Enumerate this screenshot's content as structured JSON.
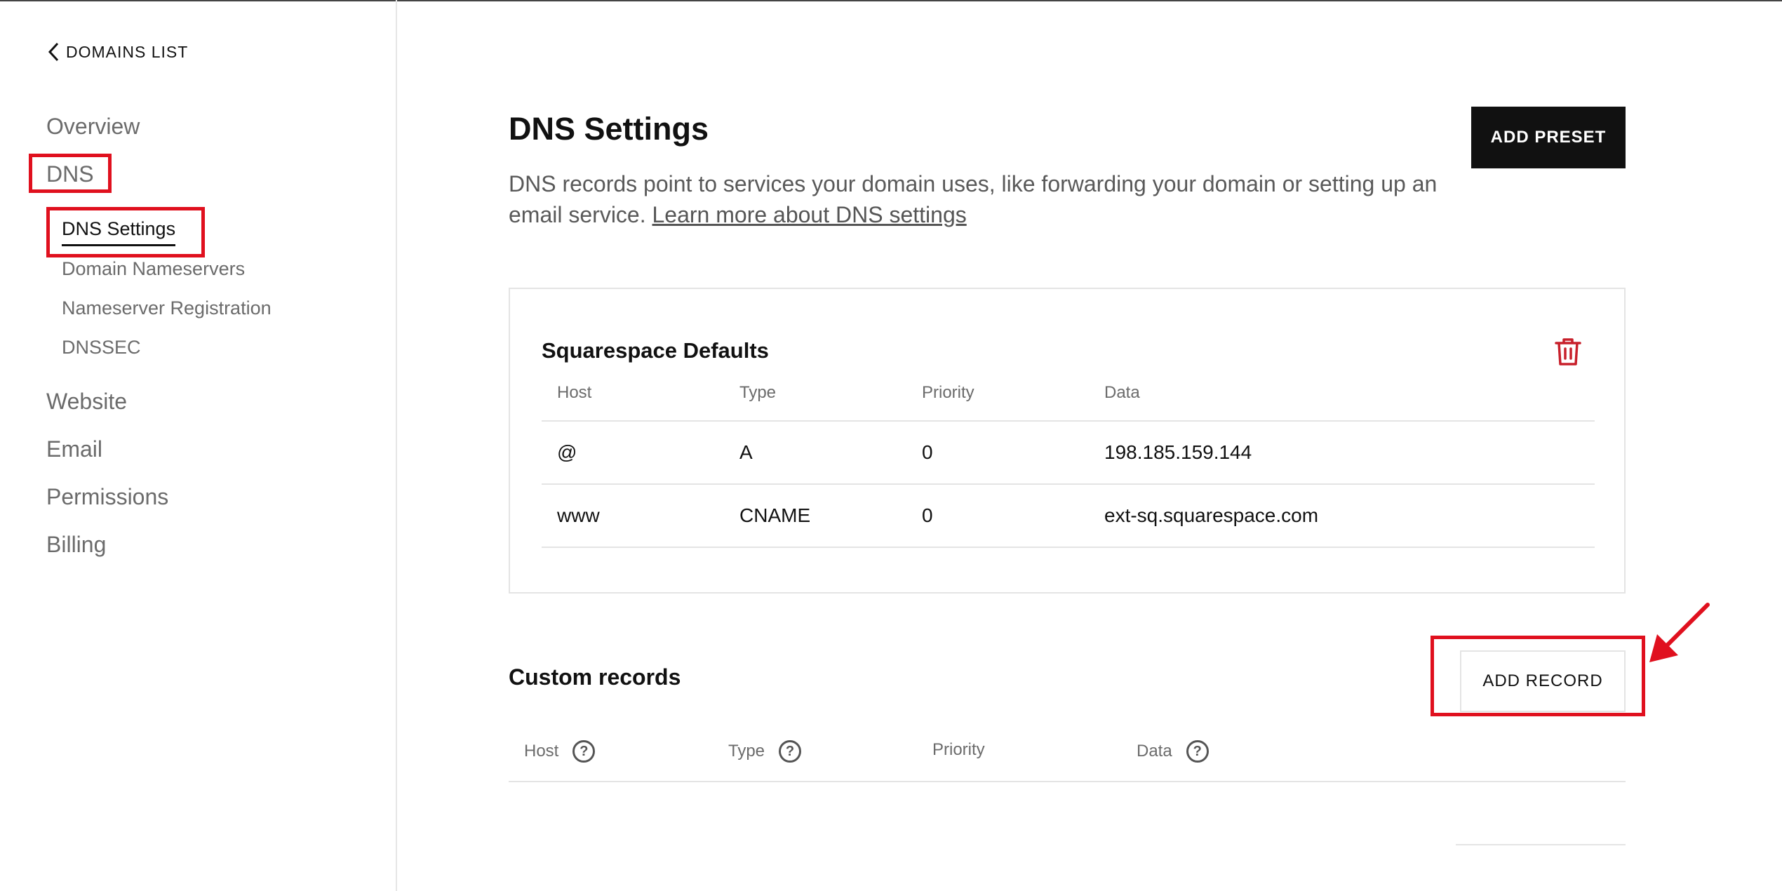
{
  "sidebar": {
    "back_label": "DOMAINS LIST",
    "nav": {
      "overview": "Overview",
      "dns": "DNS",
      "website": "Website",
      "email": "Email",
      "permissions": "Permissions",
      "billing": "Billing"
    },
    "dns_sub": {
      "settings": "DNS Settings",
      "nameservers": "Domain Nameservers",
      "registration": "Nameserver Registration",
      "dnssec": "DNSSEC"
    }
  },
  "header": {
    "title": "DNS Settings",
    "description": "DNS records point to services your domain uses, like forwarding your domain or setting up an email service.",
    "learn_more": "Learn more about DNS settings",
    "add_preset": "ADD PRESET"
  },
  "defaults": {
    "title": "Squarespace Defaults",
    "columns": [
      "Host",
      "Type",
      "Priority",
      "Data"
    ],
    "rows": [
      [
        "@",
        "A",
        "0",
        "198.185.159.144"
      ],
      [
        "www",
        "CNAME",
        "0",
        "ext-sq.squarespace.com"
      ]
    ]
  },
  "custom": {
    "title": "Custom records",
    "add_record": "ADD RECORD",
    "columns": [
      "Host",
      "Type",
      "Priority",
      "Data"
    ],
    "help_glyph": "?"
  },
  "colors": {
    "highlight": "#e0101e",
    "trash": "#c8202b",
    "primary_button": "#111111"
  },
  "icons": [
    "chevron-left-icon",
    "trash-icon",
    "help-icon",
    "red-arrow"
  ]
}
